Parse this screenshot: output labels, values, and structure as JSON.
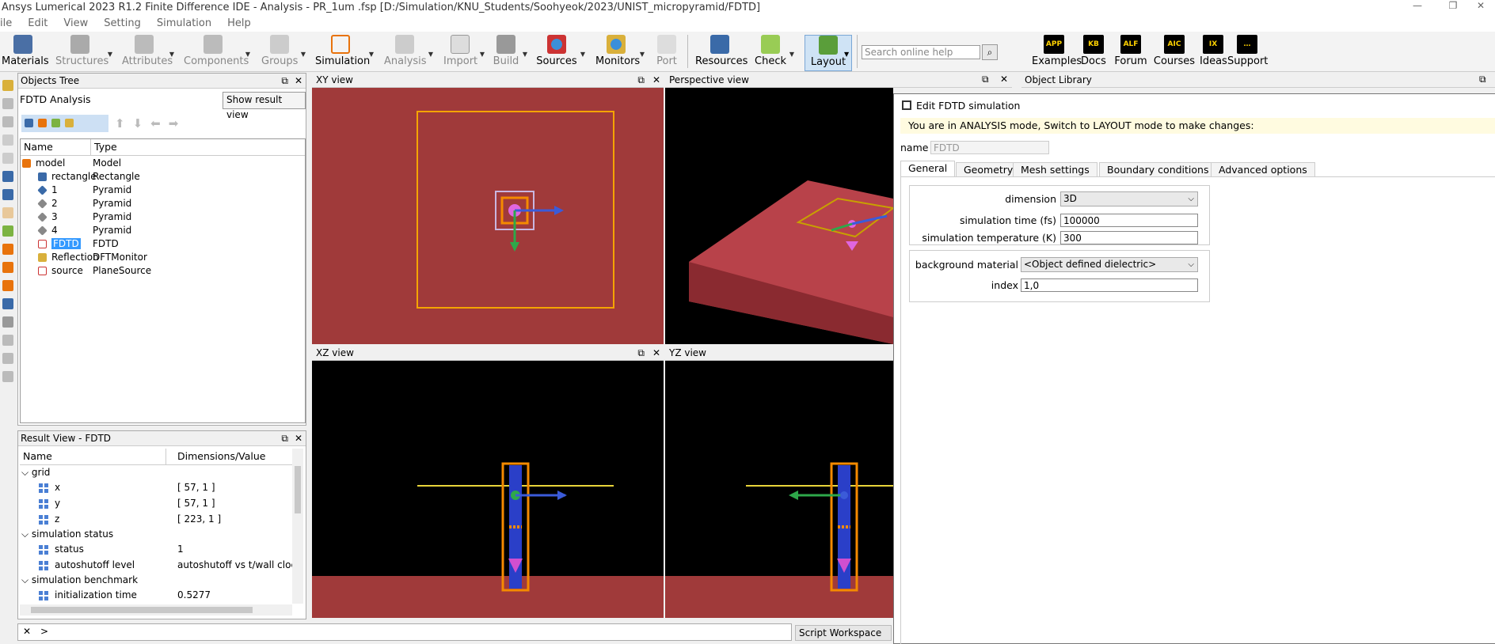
{
  "window": {
    "title": "Ansys Lumerical 2023 R1.2 Finite Difference IDE - Analysis - PR_1um .fsp [D:/Simulation/KNU_Students/Soohyeok/2023/UNIST_micropyramid/FDTD]",
    "controls": [
      "—",
      "❐",
      "✕"
    ]
  },
  "menu": [
    "ile",
    "Edit",
    "View",
    "Setting",
    "Simulation",
    "Help"
  ],
  "toolbar": {
    "buttons": [
      "Materials",
      "Structures",
      "Attributes",
      "Components",
      "Groups",
      "Simulation",
      "Analysis",
      "Import",
      "Build",
      "Sources",
      "Monitors",
      "Port",
      "Resources",
      "Check",
      "Layout"
    ],
    "search_placeholder": "Search online help",
    "help_buttons": [
      {
        "badge": "APP",
        "label": "Examples"
      },
      {
        "badge": "KB",
        "label": "Docs"
      },
      {
        "badge": "ALF",
        "label": "Forum"
      },
      {
        "badge": "AIC",
        "label": "Courses"
      },
      {
        "badge": "IX",
        "label": "Ideas"
      },
      {
        "badge": "…",
        "label": "Support"
      }
    ]
  },
  "objects_tree": {
    "title": "Objects Tree",
    "analysis_label": "FDTD Analysis",
    "show_result_button": "Show result view",
    "columns": [
      "Name",
      "Type"
    ],
    "rows": [
      {
        "name": "model",
        "type": "Model"
      },
      {
        "name": "rectangle",
        "type": "Rectangle"
      },
      {
        "name": "1",
        "type": "Pyramid"
      },
      {
        "name": "2",
        "type": "Pyramid"
      },
      {
        "name": "3",
        "type": "Pyramid"
      },
      {
        "name": "4",
        "type": "Pyramid"
      },
      {
        "name": "FDTD",
        "type": "FDTD"
      },
      {
        "name": "Reflection",
        "type": "DFTMonitor"
      },
      {
        "name": "source",
        "type": "PlaneSource"
      }
    ]
  },
  "result_view": {
    "title": "Result View - FDTD",
    "columns": [
      "Name",
      "Dimensions/Value"
    ],
    "groups": [
      "grid",
      "simulation status",
      "simulation benchmark"
    ],
    "items": [
      {
        "name": "x",
        "value": "[ 57, 1 ]"
      },
      {
        "name": "y",
        "value": "[ 57, 1 ]"
      },
      {
        "name": "z",
        "value": "[ 223, 1 ]"
      },
      {
        "name": "status",
        "value": "1"
      },
      {
        "name": "autoshutoff level",
        "value": "autoshutoff vs t/wall clock"
      },
      {
        "name": "initialization time",
        "value": "0.5277"
      }
    ]
  },
  "views": {
    "xy": "XY view",
    "perspective": "Perspective view",
    "xz": "XZ view",
    "yz": "YZ view",
    "object_library": "Object Library"
  },
  "script": {
    "prompt": ">",
    "workspace": "Script Workspace"
  },
  "dialog": {
    "title": "Edit FDTD simulation",
    "mode_message": "You are in ANALYSIS mode,  Switch to LAYOUT mode to make changes:",
    "name_label": "name",
    "name_value": "FDTD",
    "tabs": [
      "General",
      "Geometry",
      "Mesh settings",
      "Boundary conditions",
      "Advanced options"
    ],
    "fields": {
      "dimension_label": "dimension",
      "dimension_value": "3D",
      "sim_time_label": "simulation time (fs)",
      "sim_time_value": "100000",
      "sim_temp_label": "simulation temperature (K)",
      "sim_temp_value": "300",
      "bg_material_label": "background material",
      "bg_material_value": "<Object defined dielectric>",
      "index_label": "index",
      "index_value": "1,0"
    }
  }
}
